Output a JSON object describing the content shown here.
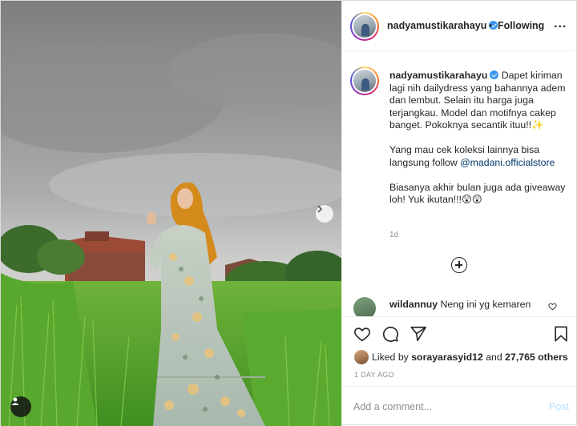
{
  "post": {
    "username": "nadyamustikarahayu",
    "follow_status": "Following",
    "dot": "•",
    "more": "...",
    "caption_user": "nadyamustikarahayu",
    "caption_body": " Dapet kiriman lagi nih dailydress yang bahannya adem dan lembut. Selain itu harga juga terjangkau. Model dan motifnya cakep banget. Pokoknya secantik ituu!!✨\n\nYang mau cek koleksi lainnya bisa langsung follow ",
    "caption_link": "@madani.officialstore",
    "caption_tail": "\n\nBiasanya akhir bulan juga ada giveaway loh! Yuk ikutan!!!😲😲",
    "caption_time": "1d",
    "comment": {
      "username": "wildannuy",
      "text": " Neng ini yg kemaren"
    },
    "likes": {
      "prefix": "Liked by ",
      "user": "sorayarasyid12",
      "middle": " and ",
      "others": "27,765 others"
    },
    "date": "1 DAY AGO",
    "add_comment_placeholder": "Add a comment...",
    "post_label": "Post"
  },
  "icons": {
    "verified": "verified-badge-icon",
    "next": "chevron-right-icon",
    "user_tag": "user-tag-icon",
    "like": "heart-icon",
    "comment": "comment-icon",
    "share": "share-icon",
    "save": "bookmark-icon",
    "load_more": "plus-circle-icon"
  },
  "colors": {
    "link": "#00376b",
    "post_button_disabled": "#b2dffc",
    "muted": "#8e8e8e",
    "verified": "#3897f0"
  }
}
